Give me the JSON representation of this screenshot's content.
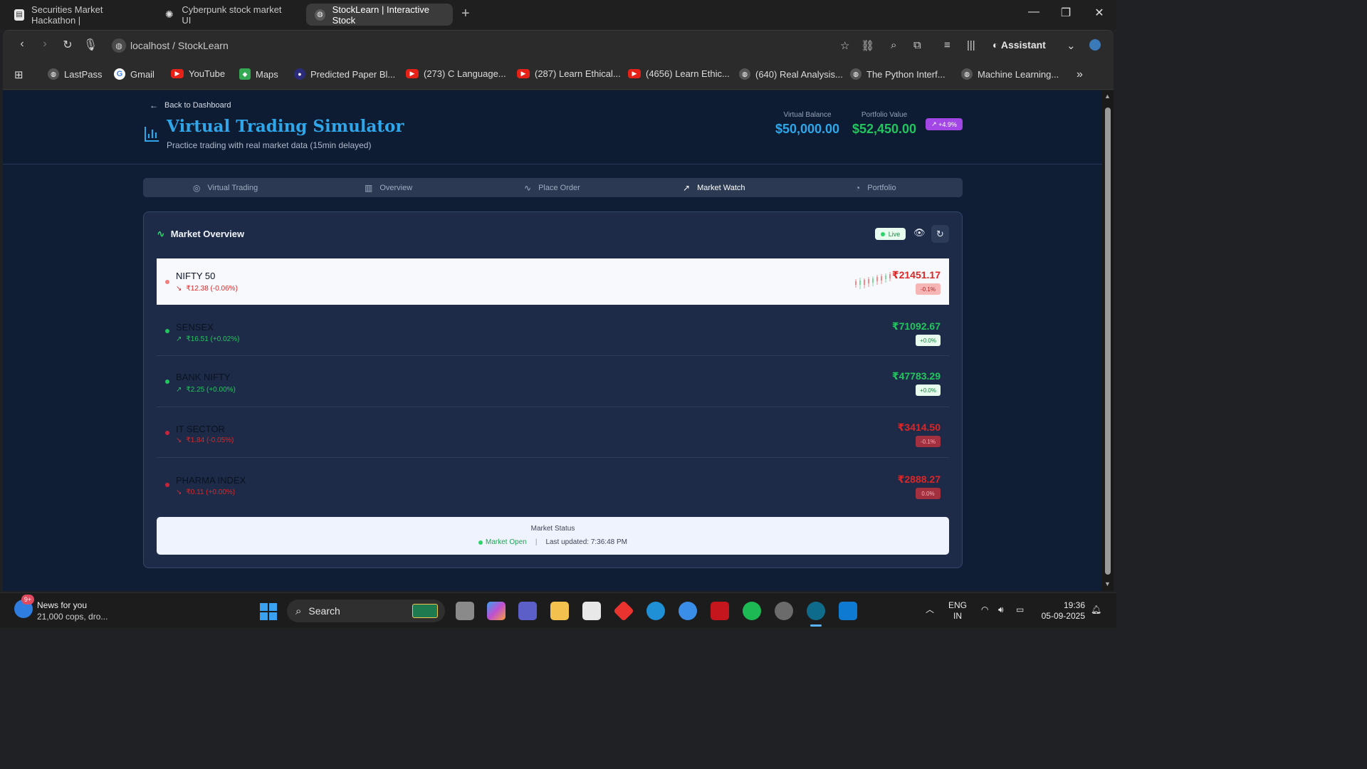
{
  "browser": {
    "tabs": [
      {
        "title": "Securities Market Hackathon |",
        "active": false
      },
      {
        "title": "Cyberpunk stock market UI",
        "active": false
      },
      {
        "title": "StockLearn | Interactive Stock",
        "active": true
      }
    ],
    "new_tab_label": "+",
    "address": "localhost / StockLearn",
    "assistant_label": "Assistant",
    "bookmarks": [
      {
        "label": "LastPass",
        "icon": "globe-icon"
      },
      {
        "label": "Gmail",
        "icon": "google-icon"
      },
      {
        "label": "YouTube",
        "icon": "youtube-icon"
      },
      {
        "label": "Maps",
        "icon": "maps-icon"
      },
      {
        "label": "Predicted Paper Bl...",
        "icon": "site-icon"
      },
      {
        "label": "(273) C Language...",
        "icon": "youtube-icon"
      },
      {
        "label": "(287) Learn Ethical...",
        "icon": "youtube-icon"
      },
      {
        "label": "(4656) Learn Ethic...",
        "icon": "youtube-icon"
      },
      {
        "label": "(640) Real Analysis...",
        "icon": "globe-icon"
      },
      {
        "label": "The Python Interf...",
        "icon": "globe-icon"
      },
      {
        "label": "Machine Learning...",
        "icon": "globe-icon"
      }
    ]
  },
  "header": {
    "back_label": "Back to Dashboard",
    "title": "Virtual Trading Simulator",
    "subtitle": "Practice trading with real market data (15min delayed)",
    "virtual_balance_label": "Virtual Balance",
    "virtual_balance": "$50,000.00",
    "portfolio_value_label": "Portfolio Value",
    "portfolio_value": "$52,450.00",
    "portfolio_change": "+4.9%"
  },
  "tabs": [
    {
      "label": "Virtual Trading",
      "icon": "play-circle-icon",
      "active": false
    },
    {
      "label": "Overview",
      "icon": "bar-chart-icon",
      "active": false
    },
    {
      "label": "Place Order",
      "icon": "activity-icon",
      "active": false
    },
    {
      "label": "Market Watch",
      "icon": "trending-up-icon",
      "active": true
    },
    {
      "label": "Portfolio",
      "icon": "pie-chart-icon",
      "active": false
    }
  ],
  "market": {
    "title": "Market Overview",
    "live_label": "Live",
    "indices": [
      {
        "name": "NIFTY 50",
        "change": "₹12.38 (-0.06%)",
        "price": "₹21451.17",
        "badge": "-0.1%",
        "direction": "down",
        "highlighted": true
      },
      {
        "name": "SENSEX",
        "change": "₹16.51 (+0.02%)",
        "price": "₹71092.67",
        "badge": "+0.0%",
        "direction": "up",
        "highlighted": false
      },
      {
        "name": "BANK NIFTY",
        "change": "₹2.25 (+0.00%)",
        "price": "₹47783.29",
        "badge": "+0.0%",
        "direction": "up",
        "highlighted": false
      },
      {
        "name": "IT SECTOR",
        "change": "₹1.84 (-0.05%)",
        "price": "₹3414.50",
        "badge": "-0.1%",
        "direction": "down",
        "highlighted": false
      },
      {
        "name": "PHARMA INDEX",
        "change": "₹0.11 (+0.00%)",
        "price": "₹2888.27",
        "badge": "0.0%",
        "direction": "down",
        "highlighted": false
      }
    ],
    "status_title": "Market Status",
    "status_open": "Market Open",
    "status_sep": "|",
    "last_updated": "Last updated: 7:36:48 PM"
  },
  "colors": {
    "up": "#22c55e",
    "down": "#dc2626",
    "accent": "#2fa6ea",
    "portfolio": "#22c55e"
  },
  "taskbar": {
    "news_title": "News for you",
    "news_sub": "21,000 cops, dro...",
    "news_badge": "9+",
    "search_label": "Search",
    "lang_line1": "ENG",
    "lang_line2": "IN",
    "time": "19:36",
    "date": "05-09-2025"
  }
}
